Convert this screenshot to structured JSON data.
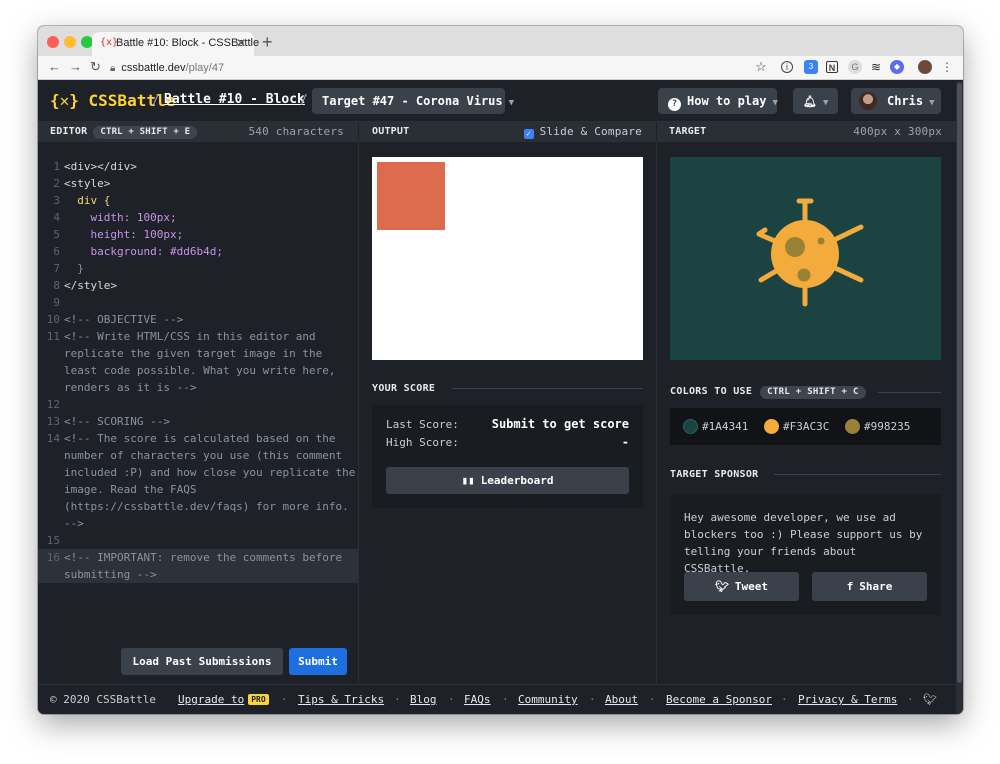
{
  "browser": {
    "tab_title": "Battle #10: Block - CSSBattle",
    "tab_favicon": "{x}",
    "url_host": "cssbattle.dev",
    "url_path": "/play/47",
    "ext_bars_badge": "3"
  },
  "header": {
    "logo": "{✕} CSSBattle",
    "battle_link": "Battle #10 - Block",
    "target_dropdown": "Target #47 - Corona Virus",
    "how_to_play": "How to play",
    "user_name": "Chris"
  },
  "editor": {
    "title": "EDITOR",
    "shortcut": "CTRL + SHIFT + E",
    "char_count": "540 characters",
    "load_button": "Load Past Submissions",
    "submit_button": "Submit",
    "lines": [
      {
        "n": "1",
        "text": "<div></div>"
      },
      {
        "n": "2",
        "text": "<style>"
      },
      {
        "n": "3",
        "text": "  div {"
      },
      {
        "n": "4",
        "text": "    width: 100px;"
      },
      {
        "n": "5",
        "text": "    height: 100px;"
      },
      {
        "n": "6",
        "text": "    background: #dd6b4d;"
      },
      {
        "n": "7",
        "text": "  }"
      },
      {
        "n": "8",
        "text": "</style>"
      },
      {
        "n": "9",
        "text": ""
      },
      {
        "n": "10",
        "text": "<!-- OBJECTIVE -->"
      },
      {
        "n": "11",
        "text": "<!-- Write HTML/CSS in this editor and"
      },
      {
        "n": "",
        "text": "replicate the given target image in the"
      },
      {
        "n": "",
        "text": "least code possible. What you write here,"
      },
      {
        "n": "",
        "text": "renders as it is -->"
      },
      {
        "n": "12",
        "text": ""
      },
      {
        "n": "13",
        "text": "<!-- SCORING -->"
      },
      {
        "n": "14",
        "text": "<!-- The score is calculated based on the"
      },
      {
        "n": "",
        "text": "number of characters you use (this comment"
      },
      {
        "n": "",
        "text": "included :P) and how close you replicate the"
      },
      {
        "n": "",
        "text": "image. Read the FAQS"
      },
      {
        "n": "",
        "text": "(https://cssbattle.dev/faqs) for more info."
      },
      {
        "n": "",
        "text": "-->"
      },
      {
        "n": "15",
        "text": ""
      },
      {
        "n": "16",
        "text": "<!-- IMPORTANT: remove the comments before"
      },
      {
        "n": "",
        "text": "submitting -->"
      }
    ]
  },
  "output": {
    "title": "OUTPUT",
    "slide_compare": "Slide & Compare",
    "square_color": "#dd6b4d"
  },
  "score": {
    "title": "YOUR SCORE",
    "last_label": "Last Score:",
    "last_value": "Submit to get score",
    "high_label": "High Score:",
    "high_value": "-",
    "leaderboard": "Leaderboard"
  },
  "target": {
    "title": "TARGET",
    "size": "400px x 300px",
    "colors_title": "COLORS TO USE",
    "colors_shortcut": "CTRL + SHIFT + C",
    "colors": [
      {
        "hex": "#1A4341"
      },
      {
        "hex": "#F3AC3C"
      },
      {
        "hex": "#998235"
      }
    ],
    "sponsor_title": "TARGET SPONSOR",
    "sponsor_text": "Hey awesome developer, we use ad blockers too :) Please support us by telling your friends about CSSBattle.",
    "tweet": "Tweet",
    "share": "Share"
  },
  "footer": {
    "copyright": "© 2020 CSSBattle",
    "upgrade": "Upgrade to",
    "pro_badge": "PRO",
    "tips": "Tips & Tricks",
    "blog": "Blog",
    "faqs": "FAQs",
    "community": "Community",
    "about": "About",
    "sponsor": "Become a Sponsor",
    "privacy": "Privacy & Terms"
  }
}
